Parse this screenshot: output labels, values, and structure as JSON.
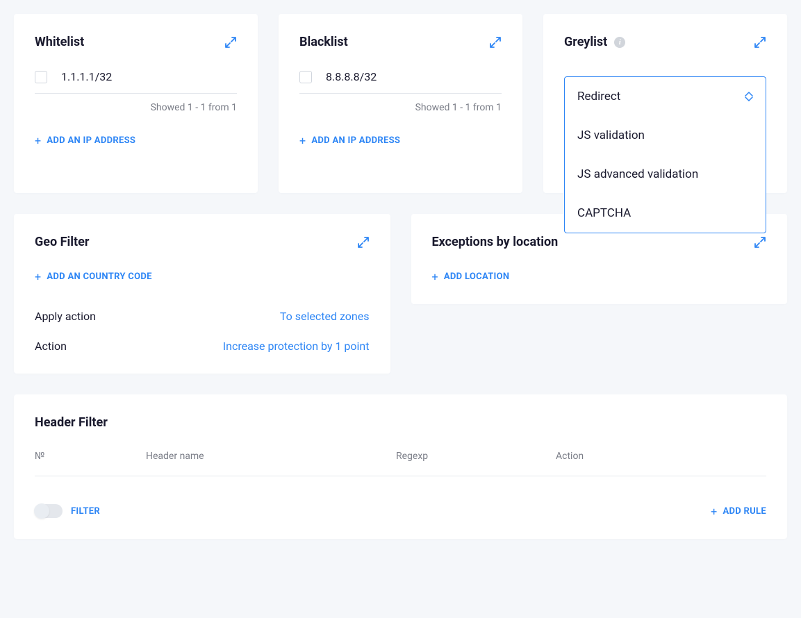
{
  "whitelist": {
    "title": "Whitelist",
    "ip": "1.1.1.1/32",
    "showed": "Showed 1 - 1 from 1",
    "add_label": "ADD AN IP ADDRESS"
  },
  "blacklist": {
    "title": "Blacklist",
    "ip": "8.8.8.8/32",
    "showed": "Showed 1 - 1 from 1",
    "add_label": "ADD AN IP ADDRESS"
  },
  "greylist": {
    "title": "Greylist",
    "options": {
      "redirect": "Redirect",
      "js_validation": "JS validation",
      "js_advanced": "JS advanced validation",
      "captcha": "CAPTCHA"
    }
  },
  "geofilter": {
    "title": "Geo Filter",
    "add_label": "ADD AN COUNTRY CODE",
    "apply_action_label": "Apply action",
    "apply_action_value": "To selected zones",
    "action_label": "Action",
    "action_value": "Increase protection by 1 point"
  },
  "exceptions": {
    "title": "Exceptions by location",
    "add_label": "ADD LOCATION"
  },
  "headerfilter": {
    "title": "Header Filter",
    "cols": {
      "num": "№",
      "name": "Header name",
      "regexp": "Regexp",
      "action": "Action"
    },
    "filter_label": "FILTER",
    "add_rule_label": "ADD RULE"
  }
}
